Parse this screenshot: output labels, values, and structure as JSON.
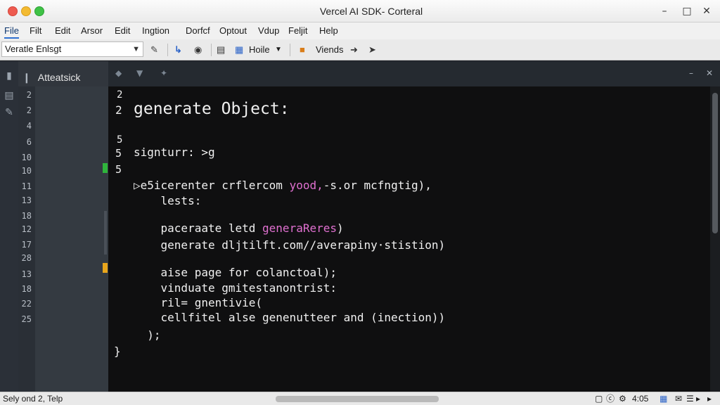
{
  "window": {
    "title": "Vercel AI SDK- Corteral"
  },
  "menu": [
    "File",
    "Filt",
    "Edit",
    "Arsor",
    "Edit",
    "Ingtion",
    "Dorfcf",
    "Optout",
    "Vdup",
    "Feljit",
    "Help"
  ],
  "toolbar": {
    "combo_value": "Veratle Enlsgt",
    "view_label": "Hoile",
    "friends_label": "Viends"
  },
  "panel": {
    "title": "Atteatsick"
  },
  "gutter_numbers": [
    "2",
    "2",
    "4",
    "6",
    "10",
    "10",
    "11",
    "13",
    "18",
    "12",
    "17",
    "28",
    "13",
    "18",
    "22",
    "25"
  ],
  "code_lines": [
    {
      "num": "2",
      "text": ""
    },
    {
      "num": "2",
      "text": "generate Object:"
    },
    {
      "num": "5",
      "text": ""
    },
    {
      "num": "5",
      "text": "signturr: >g"
    },
    {
      "num": "5",
      "text": ""
    },
    {
      "num": "",
      "pre": "▷e5icerenter crflercom ",
      "pink": "yood,",
      "post": "-s.or mcfngtig),"
    },
    {
      "num": "",
      "text": "    lests:"
    },
    {
      "num": "",
      "pre": "    paceraate letd ",
      "pink": "generaReres",
      "post": ")"
    },
    {
      "num": "",
      "text": "    generate dljtilft.com//averapiny·stistion)"
    },
    {
      "num": "",
      "text": "    aise page for colanctoal);"
    },
    {
      "num": "",
      "text": "    vinduate gmitestanontrist:"
    },
    {
      "num": "",
      "text": "    ril= gnentivie("
    },
    {
      "num": "",
      "text": "    cellfitel alse genenutteer and (inection))"
    },
    {
      "num": "",
      "text": "  );"
    },
    {
      "num": "",
      "text": "}"
    }
  ],
  "status": {
    "left": "Sely ond 2, Telp",
    "position": "4:05"
  }
}
